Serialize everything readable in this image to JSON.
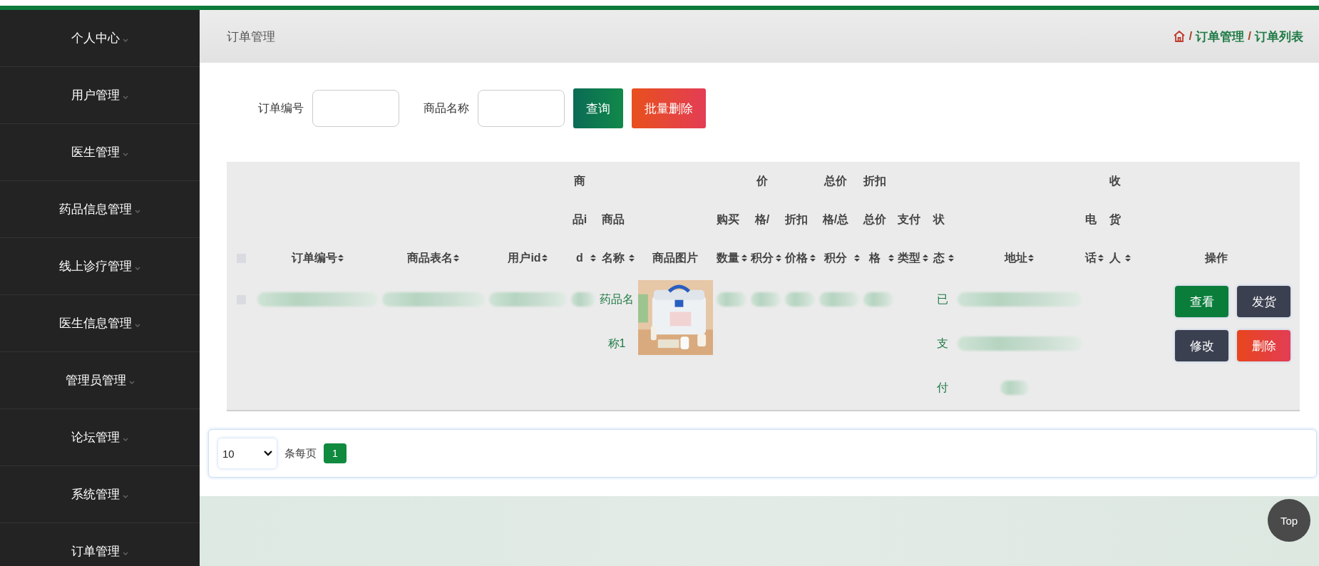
{
  "sidebar": {
    "items": [
      {
        "label": "个人中心"
      },
      {
        "label": "用户管理"
      },
      {
        "label": "医生管理"
      },
      {
        "label": "药品信息管理"
      },
      {
        "label": "线上诊疗管理"
      },
      {
        "label": "医生信息管理"
      },
      {
        "label": "管理员管理"
      },
      {
        "label": "论坛管理"
      },
      {
        "label": "系统管理"
      },
      {
        "label": "订单管理"
      }
    ]
  },
  "header": {
    "title": "订单管理",
    "breadcrumb": [
      {
        "kind": "separator",
        "text": "/"
      },
      {
        "kind": "link",
        "text": "订单管理"
      },
      {
        "kind": "separator",
        "text": "/"
      },
      {
        "kind": "link",
        "text": "订单列表"
      }
    ]
  },
  "search": {
    "fields": [
      {
        "label": "订单编号"
      },
      {
        "label": "商品名称"
      }
    ],
    "buttons": [
      {
        "label": "查询",
        "kind": "primary"
      },
      {
        "label": "批量删除",
        "kind": "danger"
      }
    ]
  },
  "table": {
    "columns": [
      {
        "kind": "checkbox",
        "checked": false
      },
      {
        "kind": "text",
        "label": "订单编号",
        "sortable": true
      },
      {
        "kind": "text",
        "label": "商品表名",
        "sortable": true
      },
      {
        "kind": "text",
        "label": "用户id",
        "sortable": true
      },
      {
        "kind": "text",
        "label": "商品id",
        "sortable": true
      },
      {
        "kind": "text",
        "label": "商品名称",
        "sortable": true
      },
      {
        "kind": "text",
        "label": "商品图片",
        "sortable": false
      },
      {
        "kind": "text",
        "label": "购买数量",
        "sortable": true
      },
      {
        "kind": "text",
        "label": "价格/积分",
        "sortable": true
      },
      {
        "kind": "text",
        "label": "折扣价格",
        "sortable": true
      },
      {
        "kind": "text",
        "label": "总价格/总积分",
        "sortable": true
      },
      {
        "kind": "text",
        "label": "折扣总价格",
        "sortable": true
      },
      {
        "kind": "text",
        "label": "支付类型",
        "sortable": true
      },
      {
        "kind": "text",
        "label": "状态",
        "sortable": true
      },
      {
        "kind": "text",
        "label": "地址",
        "sortable": true
      },
      {
        "kind": "text",
        "label": "电话",
        "sortable": true
      },
      {
        "kind": "text",
        "label": "收货人",
        "sortable": true
      },
      {
        "kind": "text",
        "label": "操作",
        "sortable": false
      }
    ],
    "rows": [
      {
        "checked": false,
        "cells": [
          {
            "kind": "checkbox"
          },
          {
            "kind": "blurred"
          },
          {
            "kind": "blurred"
          },
          {
            "kind": "blurred"
          },
          {
            "kind": "blurred"
          },
          {
            "kind": "text",
            "text": "药品名称1"
          },
          {
            "kind": "picture"
          },
          {
            "kind": "blurred"
          },
          {
            "kind": "blurred"
          },
          {
            "kind": "blurred"
          },
          {
            "kind": "blurred"
          },
          {
            "kind": "blurred"
          },
          {
            "kind": "empty"
          },
          {
            "kind": "text",
            "text": "已支付"
          },
          {
            "kind": "blurred_block"
          },
          {
            "kind": "empty"
          },
          {
            "kind": "empty"
          },
          {
            "kind": "actions",
            "buttons": [
              {
                "label": "查看",
                "kind": "success"
              },
              {
                "label": "发货",
                "kind": "dark"
              },
              {
                "label": "修改",
                "kind": "dark"
              },
              {
                "label": "删除",
                "kind": "danger"
              }
            ]
          }
        ]
      }
    ]
  },
  "pagination": {
    "page_size": "10",
    "label": "条每页",
    "pages": [
      {
        "label": "1",
        "selected": true
      }
    ]
  },
  "top_button": {
    "label": "Top"
  }
}
